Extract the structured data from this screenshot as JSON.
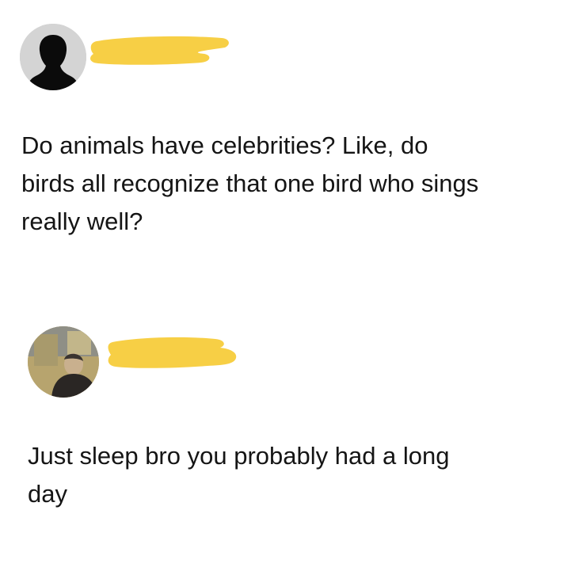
{
  "posts": [
    {
      "avatar_icon": "silhouette-avatar-icon",
      "username_redacted": true,
      "text": "Do animals have celebrities? Like, do\nbirds all recognize that one bird who sings\nreally well?"
    },
    {
      "avatar_icon": "photo-avatar-icon",
      "username_redacted": true,
      "text": "Just sleep bro you probably had a long\nday"
    }
  ],
  "colors": {
    "redaction": "#f7cf45",
    "background": "#ffffff",
    "text": "#151515"
  }
}
